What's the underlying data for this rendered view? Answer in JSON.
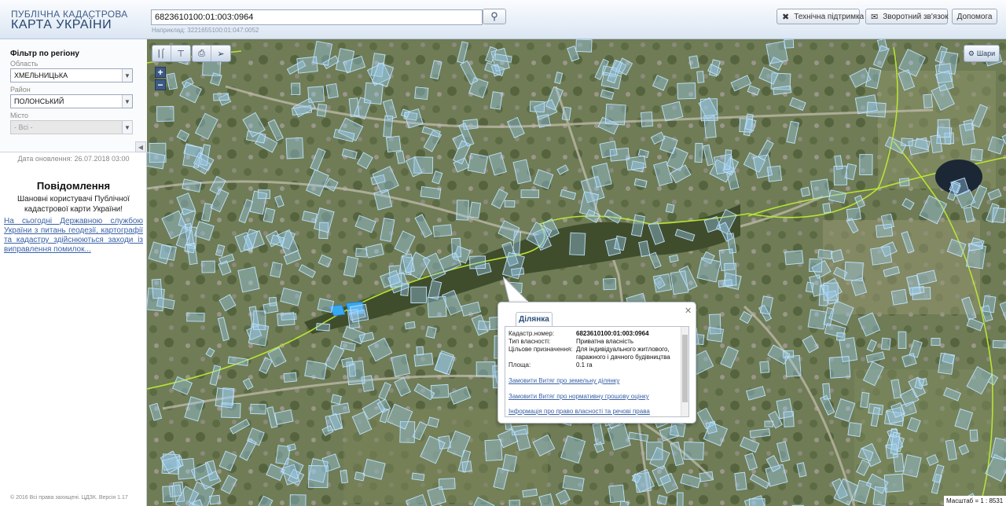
{
  "header": {
    "logo_line1": "ПУБЛІЧНА КАДАСТРОВА",
    "logo_line2": "КАРТА УКРАЇНИ",
    "search_value": "6823610100:01:003:0964",
    "search_hint": "Наприклад: 3221655100:01:047:0052",
    "buttons": {
      "support": "Технічна підтримка",
      "feedback": "Зворотний зв'язок",
      "help": "Допомога"
    }
  },
  "sidebar": {
    "filter_title": "Фільтр по регіону",
    "region_label": "Область",
    "region_value": "ХМЕЛЬНИЦЬКА",
    "district_label": "Район",
    "district_value": "ПОЛОНСЬКИЙ",
    "city_label": "Місто",
    "city_value": "- Всі -",
    "update_date": "Дата оновлення: 26.07.2018 03:00",
    "notice_title": "Повідомлення",
    "notice_text": "Шановні користувачі Публічної кадастрової карти України!",
    "notice_link": "На сьогодні Державною службою України з питань геодезії, картографії та кадастру здійснюються заходи із виправлення помилок...",
    "copyright": "© 2016 Всі права захищені. ЦДЗК. Версія 1.17"
  },
  "map": {
    "layers_label": "Шари",
    "scale_label": "Масштаб = 1 : 8531",
    "toolbar_icons": [
      "distance-measure-icon",
      "area-measure-icon",
      "print-icon",
      "identify-pointer-icon"
    ]
  },
  "popup": {
    "tab": "Ділянка",
    "fields": [
      {
        "label": "Кадастр.номер:",
        "value": "6823610100:01:003:0964"
      },
      {
        "label": "Тип власності:",
        "value": "Приватна власність"
      },
      {
        "label": "Цільове призначення:",
        "value": "Для індивідуального житлового, гаражного і дачного будівництва"
      },
      {
        "label": "Площа:",
        "value": "0.1 га"
      }
    ],
    "links": [
      "Замовити Витяг про земельну ділянку",
      "Замовити Витяг про нормативну грошову оцінку",
      "Інформація про право власності та речові права"
    ]
  },
  "colors": {
    "boundary": "#b8e335",
    "parcel_fill": "#9fd0f5",
    "link": "#3a62a8"
  }
}
